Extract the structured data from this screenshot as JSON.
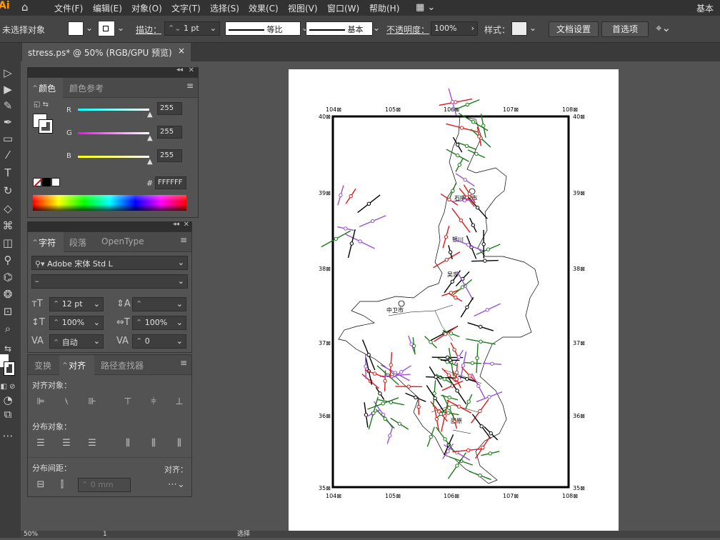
{
  "menubar": {
    "logo": "Ai",
    "items": [
      "文件(F)",
      "编辑(E)",
      "对象(O)",
      "文字(T)",
      "选择(S)",
      "效果(C)",
      "视图(V)",
      "窗口(W)",
      "帮助(H)"
    ],
    "workspace": "基本"
  },
  "options": {
    "no_selection": "未选择对象",
    "stroke_label": "描边：",
    "stroke_value": "1 pt",
    "profile1": "等比",
    "profile2": "基本",
    "opacity_label": "不透明度：",
    "opacity_value": "100%",
    "style_label": "样式：",
    "doc_setup": "文档设置",
    "preferences": "首选项"
  },
  "document": {
    "tab_title": "stress.ps* @ 50% (RGB/GPU 预览)",
    "close": "×"
  },
  "color_panel": {
    "tab_color": "颜色",
    "tab_guide": "颜色参考",
    "r_label": "R",
    "g_label": "G",
    "b_label": "B",
    "r": "255",
    "g": "255",
    "b": "255",
    "hex_label": "#",
    "hex": "FFFFFF"
  },
  "char_panel": {
    "tab_char": "字符",
    "tab_para": "段落",
    "tab_ot": "OpenType",
    "font": "Adobe 宋体 Std L",
    "style": "–",
    "size": "12 pt",
    "leading": "",
    "vscale": "100%",
    "hscale": "100%",
    "kerning": "自动",
    "tracking": "0"
  },
  "align_panel": {
    "tab_transform": "变换",
    "tab_align": "对齐",
    "tab_pathfinder": "路径查找器",
    "align_objects": "对齐对象：",
    "distribute_objects": "分布对象：",
    "distribute_spacing": "分布间距：",
    "spacing_value": "0 mm",
    "align_to": "对齐："
  },
  "map": {
    "lon_labels": [
      "104⊠",
      "105⊠",
      "106⊠",
      "107⊠",
      "108⊠"
    ],
    "lat_labels": [
      "40⊠",
      "39⊠",
      "38⊠",
      "37⊠",
      "36⊠",
      "35⊠"
    ],
    "cities": [
      "石嘴山市",
      "银川",
      "吴忠",
      "中卫市",
      "固原"
    ]
  },
  "status": {
    "zoom": "50%",
    "page": "1",
    "mode": "选择"
  },
  "colors": {
    "red": "#e01818",
    "green": "#1a7a1a",
    "purple": "#9b4fd6",
    "black": "#000000"
  }
}
